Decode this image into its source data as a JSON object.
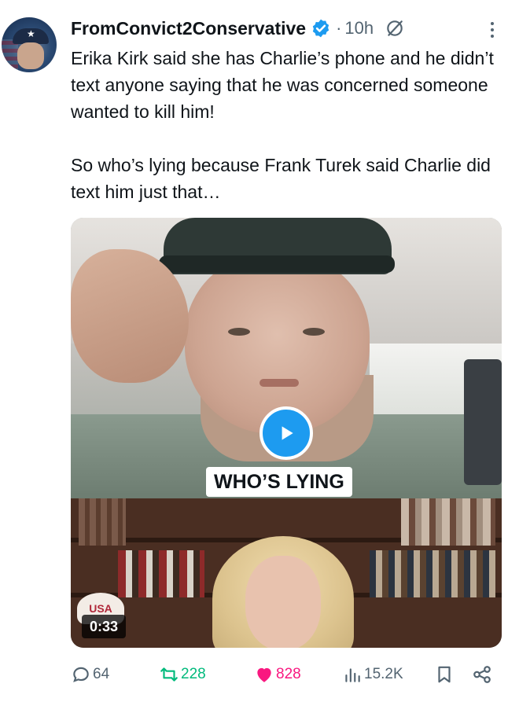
{
  "post": {
    "author_name": "FromConvict2Conservative",
    "separator": "·",
    "time": "10h",
    "paragraphs": [
      "Erika Kirk said she has Charlie’s phone and he didn’t text anyone saying that he was concerned someone wanted to kill him!",
      "So who’s lying because Frank Turek said Charlie did text him just that…"
    ]
  },
  "video": {
    "caption": "WHO’S LYING",
    "duration": "0:33",
    "sign_text": "USA"
  },
  "actions": {
    "replies": "64",
    "reposts": "228",
    "likes": "828",
    "views": "15.2K"
  },
  "icons": {
    "verified": "verified-badge-icon",
    "grok": "grok-icon",
    "more": "more-icon",
    "reply": "reply-icon",
    "repost": "repost-icon",
    "like": "heart-icon",
    "views": "views-icon",
    "bookmark": "bookmark-icon",
    "share": "share-icon"
  },
  "colors": {
    "accent": "#1d9bf0",
    "repost": "#00ba7c",
    "like": "#f91880",
    "muted": "#536471"
  }
}
